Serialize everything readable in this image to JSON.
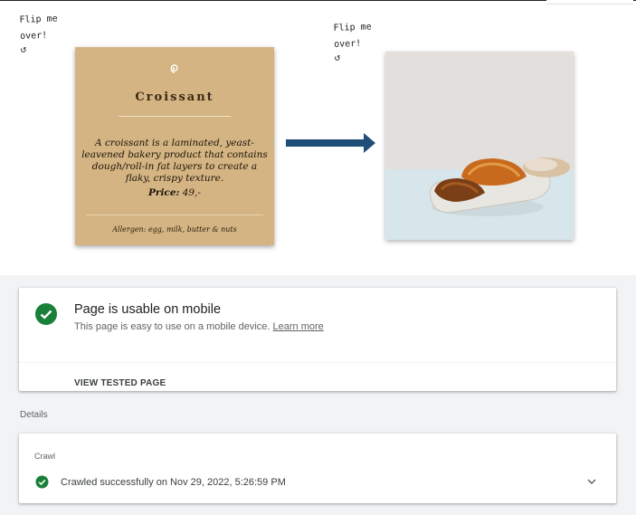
{
  "menu_card": {
    "flip_note": "Flip me over!",
    "title": "Croissant",
    "description": "A croissant is a laminated, yeast-leavened bakery product that contains dough/roll-in fat layers to create a flaky, crispy texture.",
    "price_label": "Price:",
    "price_value": "49,-",
    "allergens": "Allergen: egg, milk, butter & nuts"
  },
  "mobile_test": {
    "result_title": "Page is usable on mobile",
    "result_description": "This page is easy to use on a mobile device.",
    "learn_more_link": "Learn more",
    "view_tested_page": "VIEW TESTED PAGE",
    "details_heading": "Details",
    "crawl_section_label": "Crawl",
    "crawl_status": "Crawled successfully on Nov 29, 2022, 5:26:59 PM"
  },
  "colors": {
    "card_background": "#d4b482",
    "arrow": "#1f4e79",
    "success_green": "#188038",
    "page_gray": "#f1f3f4"
  },
  "icons": [
    "swirl-logo-icon",
    "rotate-arrow-icon",
    "right-arrow-icon",
    "check-circle-icon",
    "chevron-down-icon"
  ]
}
